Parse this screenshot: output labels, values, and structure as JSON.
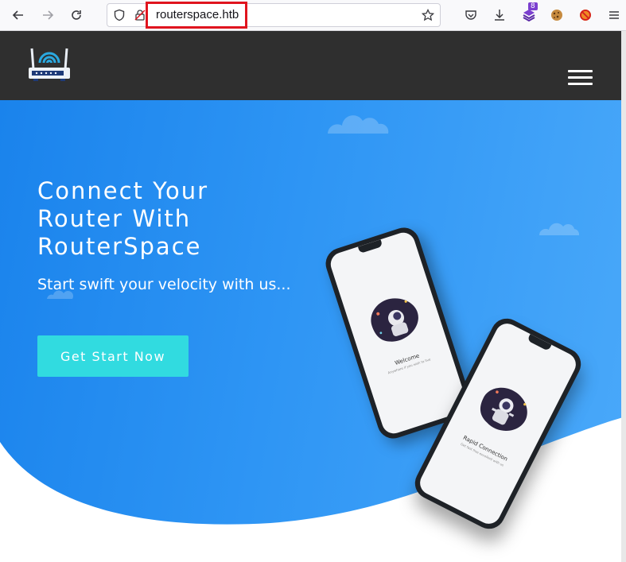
{
  "browser": {
    "url": "routerspace.htb",
    "extensions_badge": "8",
    "icons": [
      "back-icon",
      "forward-icon",
      "reload-icon",
      "shield-icon",
      "permissions-icon",
      "star-icon",
      "pocket-icon",
      "download-icon",
      "extension-icon",
      "cookie-icon",
      "blocker-icon",
      "menu-icon"
    ]
  },
  "site": {
    "logo": "router-logo",
    "hero": {
      "title": "Connect Your Router With RouterSpace",
      "subtitle": "Start swift your velocity with us...",
      "cta_label": "Get Start Now"
    },
    "phone_back": {
      "title": "Welcome",
      "caption": "Anywhere if you wish to live"
    },
    "phone_front": {
      "title": "Rapid Connection",
      "caption": "Get fast free excellent with us"
    }
  },
  "colors": {
    "header_bg": "#2f2f2f",
    "hero_blue": "#2e95f4",
    "cta": "#31dbe0",
    "highlight": "#e0141e"
  }
}
